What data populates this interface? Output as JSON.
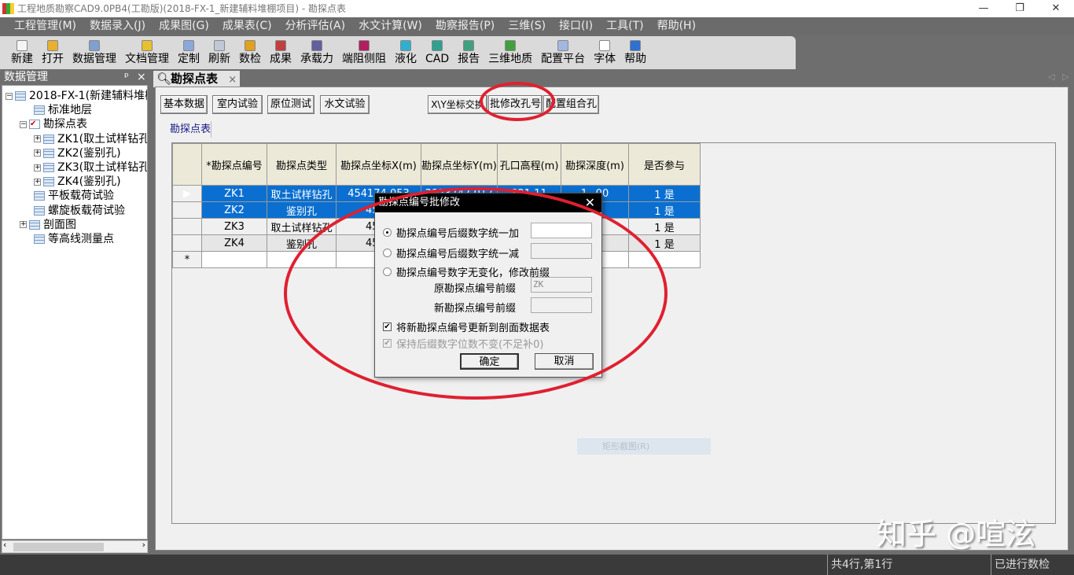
{
  "window": {
    "title": "工程地质勘察CAD9.0PB4(工勘版)(2018-FX-1_新建辅料堆棚项目) - 勘探点表",
    "minimize": "—",
    "restore": "❐",
    "close": "✕"
  },
  "menu": [
    "工程管理(M)",
    "数据录入(J)",
    "成果图(G)",
    "成果表(C)",
    "分析评估(A)",
    "水文计算(W)",
    "勘察报告(P)",
    "三维(S)",
    "接口(I)",
    "工具(T)",
    "帮助(H)"
  ],
  "toolbar": [
    {
      "label": "新建",
      "color": "#f4f4f4"
    },
    {
      "label": "打开",
      "color": "#e8b030"
    },
    {
      "label": "数据管理",
      "color": "#7fa0d0"
    },
    {
      "label": "文档管理",
      "color": "#e8c030"
    },
    {
      "label": "定制",
      "color": "#8aa8d8"
    },
    {
      "label": "刷新",
      "color": "#c0c8d8"
    },
    {
      "label": "数检",
      "color": "#e0a020"
    },
    {
      "label": "成果",
      "color": "#c04040"
    },
    {
      "label": "承载力",
      "color": "#6060a0"
    },
    {
      "label": "端阻侧阻",
      "color": "#b02060"
    },
    {
      "label": "液化",
      "color": "#30b0d0"
    },
    {
      "label": "CAD",
      "color": "#30a090"
    },
    {
      "label": "报告",
      "color": "#40a080"
    },
    {
      "label": "三维地质",
      "color": "#40a040"
    },
    {
      "label": "配置平台",
      "color": "#a0b8e0"
    },
    {
      "label": "字体",
      "color": "#ffffff"
    },
    {
      "label": "帮助",
      "color": "#3070d0"
    }
  ],
  "left_panel": {
    "title": "数据管理",
    "pin": "ᵖ",
    "close": "×",
    "tree": [
      {
        "label": "2018-FX-1(新建辅料堆棚项目)",
        "level": 0,
        "expander": "−"
      },
      {
        "label": "标准地层",
        "level": 1
      },
      {
        "label": "勘探点表",
        "level": 1,
        "expander": "−",
        "checked": true
      },
      {
        "label": "ZK1(取土试样钻孔)",
        "level": 2,
        "expander": "+"
      },
      {
        "label": "ZK2(鉴别孔)",
        "level": 2,
        "expander": "+"
      },
      {
        "label": "ZK3(取土试样钻孔)",
        "level": 2,
        "expander": "+"
      },
      {
        "label": "ZK4(鉴别孔)",
        "level": 2,
        "expander": "+"
      },
      {
        "label": "平板载荷试验",
        "level": 1
      },
      {
        "label": "螺旋板载荷试验",
        "level": 1
      },
      {
        "label": "剖面图",
        "level": 1,
        "expander": "+"
      },
      {
        "label": "等高线测量点",
        "level": 1
      }
    ]
  },
  "doc_tab": {
    "label": "勘探点表",
    "close": "×"
  },
  "buttons": [
    "基本数据",
    "室内试验",
    "原位测试",
    "水文试验",
    "X\\Y坐标交换",
    "批修改孔号",
    "配置组合孔"
  ],
  "subtab": "勘探点表",
  "table": {
    "headers": [
      "*勘探点编号",
      "勘探点类型",
      "勘探点坐标X(m)",
      "勘探点坐标Y(m)",
      "孔口高程(m)",
      "勘探深度(m)",
      "是否参与"
    ],
    "rows": [
      [
        "ZK1",
        "取土试样钻孔",
        "454174.053",
        "3823747.017",
        "821.11",
        "1_.00",
        "1 是"
      ],
      [
        "ZK2",
        "鉴别孔",
        "4541",
        "",
        "",
        "0",
        "1 是"
      ],
      [
        "ZK3",
        "取土试样钻孔",
        "4541",
        "",
        "",
        "0",
        "1 是"
      ],
      [
        "ZK4",
        "鉴别孔",
        "4541",
        "",
        "",
        "0",
        "1 是"
      ]
    ],
    "current_marker": "▶",
    "new_row_marker": "*"
  },
  "dialog": {
    "title": "勘探点编号批修改",
    "close": "✕",
    "opt_add": "勘探点编号后缀数字统一加",
    "opt_sub": "勘探点编号后缀数字统一减",
    "opt_prefix": "勘探点编号数字无变化，修改前缀",
    "old_prefix_label": "原勘探点编号前缀",
    "old_prefix_value": "ZK",
    "new_prefix_label": "新勘探点编号前缀",
    "chk_update": "将新勘探点编号更新到剖面数据表",
    "chk_keep": "保持后缀数字位数不变(不足补0)",
    "ok": "确定",
    "cancel": "取消"
  },
  "snip_overlay": "矩形截图(R)",
  "status": {
    "rows": "共4行,第1行",
    "check": "已进行数检"
  },
  "watermark": "知乎 @喧泫",
  "annotation_color": "#e02030"
}
